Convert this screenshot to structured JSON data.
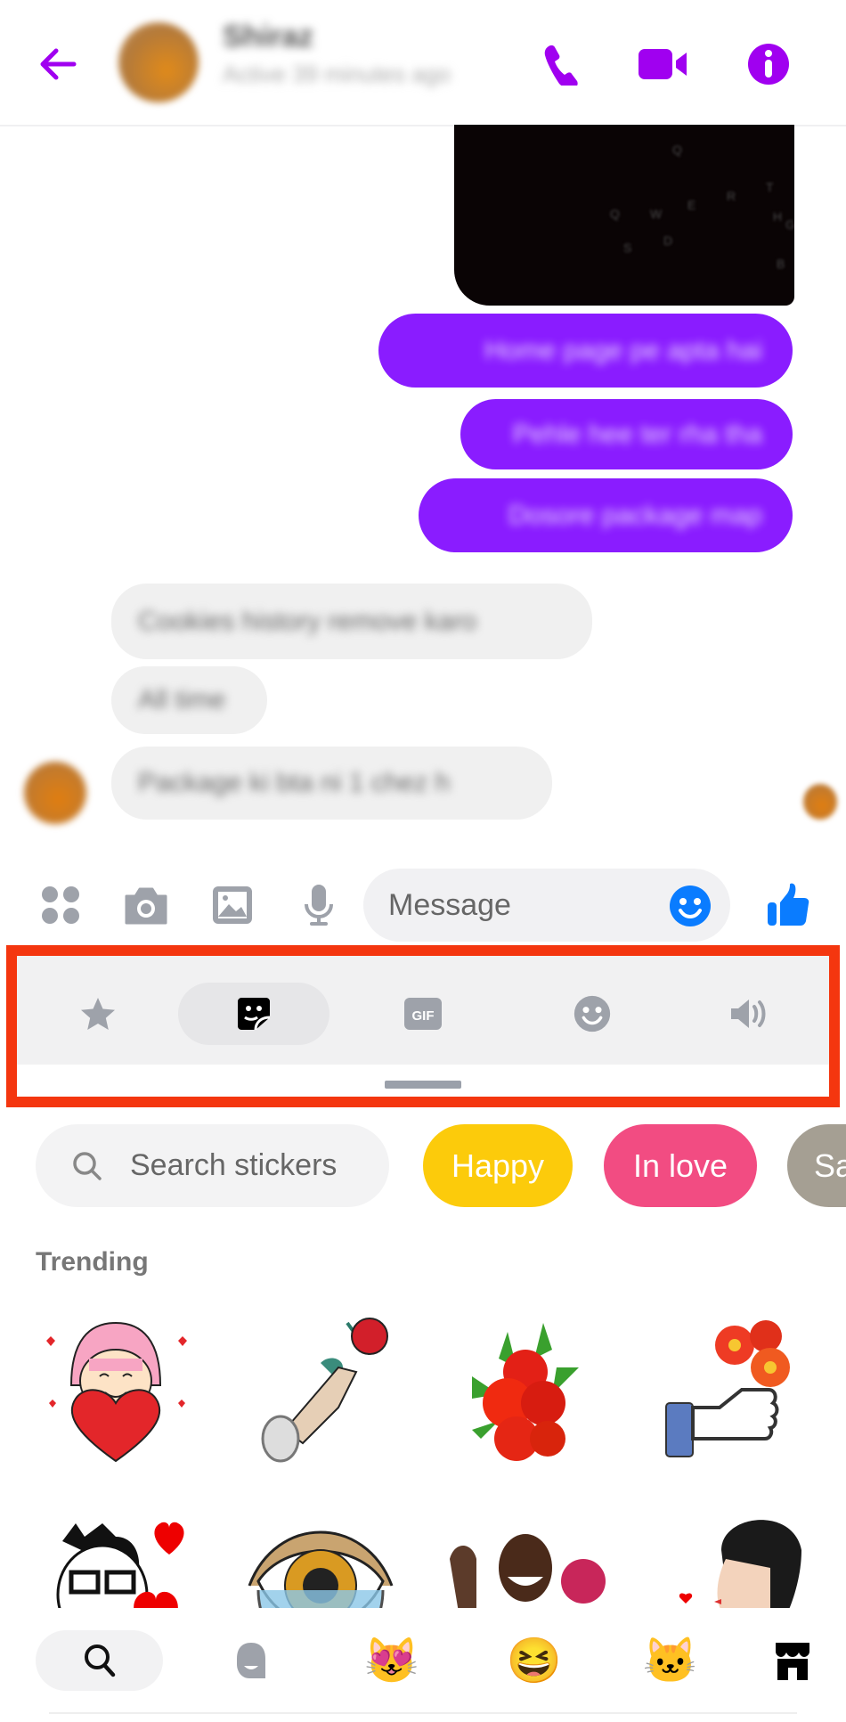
{
  "header": {
    "back_icon": "arrow-left-icon",
    "contact_name": "Shiraz",
    "contact_status": "Active 39 minutes ago",
    "actions": [
      {
        "name": "voice-call",
        "icon": "phone-icon"
      },
      {
        "name": "video-call",
        "icon": "video-camera-icon"
      },
      {
        "name": "conversation-info",
        "icon": "info-icon"
      }
    ],
    "accent_color": "#a000f0"
  },
  "chat": {
    "image_message": {
      "description": "Dark keyboard photo",
      "keys": [
        "Q",
        "W",
        "E",
        "R",
        "T",
        "Y",
        "G",
        "H",
        "B",
        "S",
        "D"
      ]
    },
    "outgoing": [
      {
        "text": "Home page pe apta hai"
      },
      {
        "text": "Pehle hee ter rha tha"
      },
      {
        "text": "Dosore package map"
      }
    ],
    "incoming": [
      {
        "text": "Cookies history remove karo"
      },
      {
        "text": "All time"
      },
      {
        "text": "Package ki bta ni 1 chez h"
      }
    ],
    "outgoing_color": "#8a1cff",
    "incoming_color": "#f0f0f0"
  },
  "composer": {
    "buttons": [
      {
        "name": "more-actions",
        "icon": "four-dots-icon"
      },
      {
        "name": "camera",
        "icon": "camera-icon"
      },
      {
        "name": "gallery",
        "icon": "image-icon"
      },
      {
        "name": "voice-message",
        "icon": "microphone-icon"
      }
    ],
    "placeholder": "Message",
    "emoji_icon": "smiley-icon",
    "like_icon": "thumbs-up-icon",
    "accent_color": "#0a7cff"
  },
  "media_tabs": {
    "tabs": [
      {
        "name": "favorites",
        "icon": "star-icon",
        "label": "Favorites",
        "selected": false
      },
      {
        "name": "stickers",
        "icon": "sticker-icon",
        "label": "Stickers",
        "selected": true
      },
      {
        "name": "gifs",
        "icon": "gif-icon",
        "label": "GIF",
        "selected": false
      },
      {
        "name": "emoji",
        "icon": "smiley-icon",
        "label": "Emoji",
        "selected": false
      },
      {
        "name": "sounds",
        "icon": "speaker-icon",
        "label": "Sounds",
        "selected": false
      }
    ],
    "highlight_color": "#f4360f"
  },
  "sticker_panel": {
    "search_placeholder": "Search stickers",
    "chips": [
      {
        "label": "Happy",
        "color": "#fccb0b"
      },
      {
        "label": "In love",
        "color": "#f24c82"
      },
      {
        "label": "Sa",
        "color": "#a59f93"
      }
    ],
    "section_title": "Trending",
    "stickers": [
      {
        "name": "girl-holding-heart",
        "emoji": "💗"
      },
      {
        "name": "hand-holding-rose",
        "emoji": "🌹"
      },
      {
        "name": "red-roses-bouquet",
        "emoji": "🌺"
      },
      {
        "name": "thumbs-up-flowers",
        "emoji": "💐"
      },
      {
        "name": "man-glasses-hearts",
        "emoji": "😘"
      },
      {
        "name": "crying-eye",
        "emoji": "👁"
      },
      {
        "name": "man-waving-roses",
        "emoji": "👋"
      },
      {
        "name": "woman-blowing-kiss",
        "emoji": "😚"
      }
    ]
  },
  "sticker_tray": {
    "items": [
      {
        "name": "search",
        "icon": "search-icon"
      },
      {
        "name": "recent",
        "icon": "recent-face-icon"
      },
      {
        "name": "cat-heart-pack",
        "emoji": "😻"
      },
      {
        "name": "laughing-face-pack",
        "emoji": "😆"
      },
      {
        "name": "pusheen-pack",
        "emoji": "🐱"
      },
      {
        "name": "sticker-store",
        "icon": "store-icon"
      }
    ]
  }
}
